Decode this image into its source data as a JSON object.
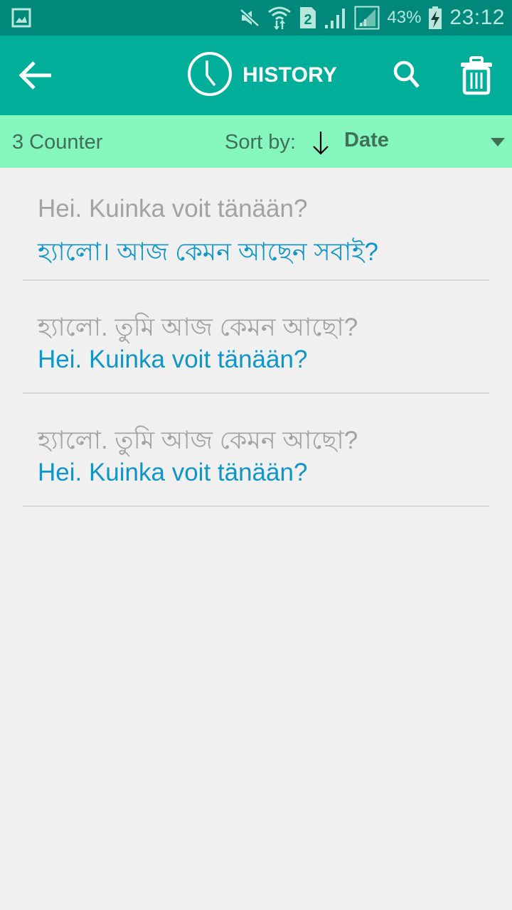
{
  "status_bar": {
    "battery_percent": "43%",
    "time": "23:12",
    "sim_slot": "2",
    "icons": [
      "gallery-notification-icon",
      "mute-icon",
      "wifi-icon",
      "sim-2-icon",
      "signal-icon",
      "signal-roaming-icon",
      "battery-charging-icon"
    ]
  },
  "toolbar": {
    "title": "HISTORY",
    "icons": {
      "back": "back-arrow-icon",
      "title": "clock-icon",
      "search": "search-icon",
      "delete": "trash-icon"
    }
  },
  "sort_bar": {
    "counter": "3 Counter",
    "sort_label": "Sort by:",
    "sort_direction": "descending",
    "sort_value": "Date"
  },
  "colors": {
    "status_bar": "#00897b",
    "toolbar": "#00ae9a",
    "sort_bar": "#85f7be",
    "sort_text": "#3f6f55",
    "background": "#f0f0f0",
    "source_text": "#a2a2a2",
    "target_text": "#0f96c8",
    "divider": "#d6d6d6"
  },
  "history": [
    {
      "source": "Hei. Kuinka voit tänään?",
      "target": "হ্যালো। আজ কেমন আছেন সবাই?"
    },
    {
      "source": "হ্যালো. তুমি আজ কেমন আছো?",
      "target": "Hei. Kuinka voit tänään?"
    },
    {
      "source": "হ্যালো. তুমি আজ কেমন আছো?",
      "target": "Hei. Kuinka voit tänään?"
    }
  ]
}
